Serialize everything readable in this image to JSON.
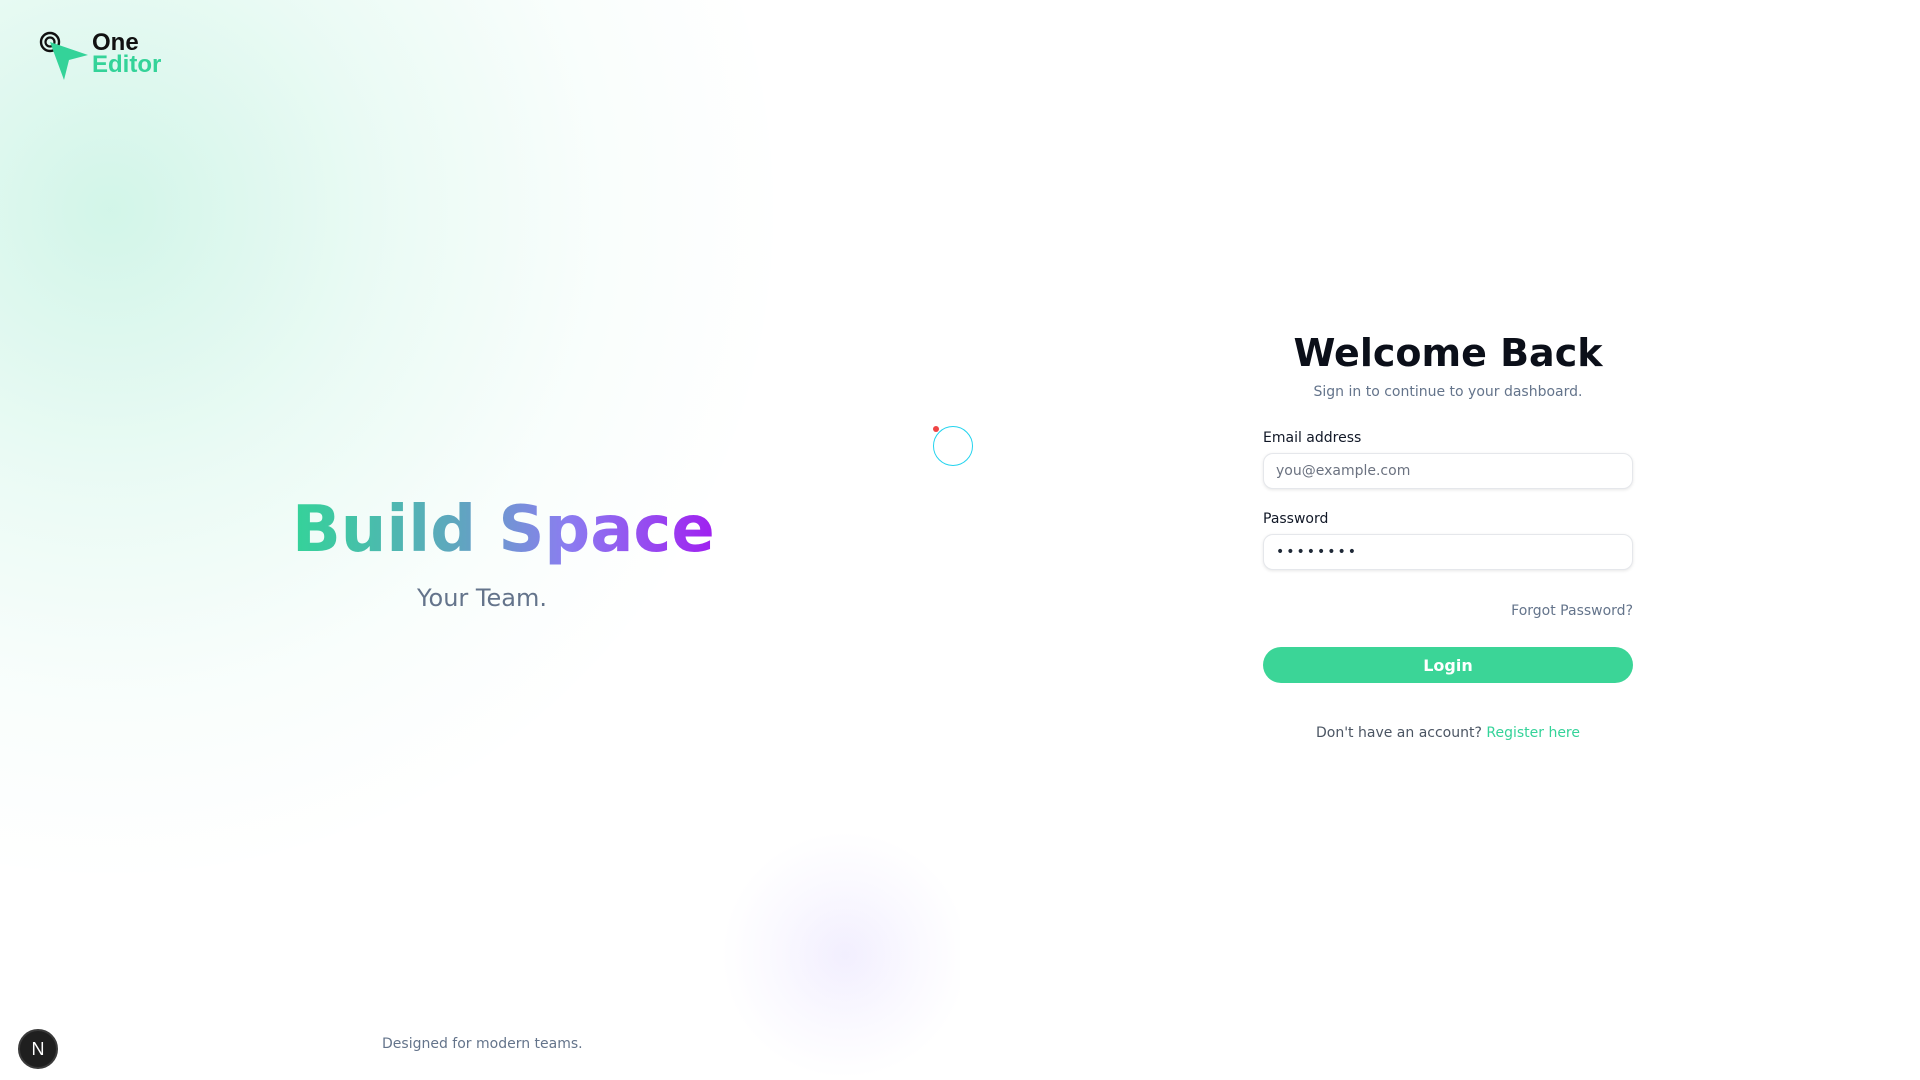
{
  "brand": {
    "line1": "One",
    "line2": "Editor",
    "accent_color": "#34d399"
  },
  "hero": {
    "title": "Build Space",
    "subtitle": "Your Team.",
    "gradient_colors": [
      "#34d399",
      "#8b7df0",
      "#a020f0"
    ]
  },
  "footer": {
    "tagline": "Designed for modern teams."
  },
  "dev_badge": {
    "label": "N"
  },
  "login": {
    "title": "Welcome Back",
    "subtitle": "Sign in to continue to your dashboard.",
    "email_label": "Email address",
    "email_placeholder": "you@example.com",
    "email_value": "",
    "password_label": "Password",
    "password_value": "••••••••",
    "forgot_label": "Forgot Password?",
    "login_button": "Login",
    "register_prompt": "Don't have an account?",
    "register_link": "Register here",
    "button_color": "#3bd597"
  },
  "icons": {
    "logo": "cursor-arrow-icon",
    "spinner": "loading-spinner-icon"
  }
}
